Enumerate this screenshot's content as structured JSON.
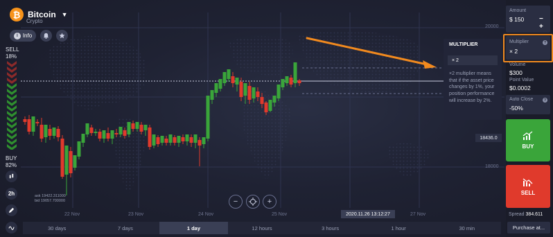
{
  "asset": {
    "name": "Bitcoin",
    "type": "Crypto"
  },
  "header_buttons": {
    "info": "Info"
  },
  "sentiment": {
    "sell_label": "SELL",
    "sell_pct": "18%",
    "buy_label": "BUY",
    "buy_pct": "82%",
    "sell_fraction": 0.18,
    "buy_fraction": 0.82
  },
  "left_tools": {
    "timeframe": "2h"
  },
  "chart": {
    "y_labels": [
      "20000",
      "18000"
    ],
    "x_labels": [
      "22 Nov",
      "23 Nov",
      "24 Nov",
      "25 Nov",
      "27 Nov"
    ],
    "bid_ask": [
      "ask 19422.311000",
      "bid 19057.700000"
    ],
    "current_price": "18436.0",
    "time": "2020.11.26 13:12:27",
    "up_color": "#3aa53a",
    "down_color": "#e03a2c"
  },
  "zoom": {
    "minus": "−",
    "plus": "+"
  },
  "multiplier_popup": {
    "title": "MULTIPLIER",
    "selected": "× 2",
    "description": "×2 multiplier means that if the asset price changes by 1%, your position performance will increase by 2%."
  },
  "trade_panel": {
    "amount_label": "Amount",
    "amount_value": "$ 150",
    "multiplier_label": "Multiplier",
    "multiplier_value": "× 2",
    "volume_label": "Volume",
    "volume_value": "$300",
    "point_value_label": "Point Value",
    "point_value_value": "$0.0002",
    "auto_close_label": "Auto Close",
    "auto_close_value": "-50%",
    "buy_label": "BUY",
    "sell_label": "SELL",
    "spread_label": "Spread",
    "spread_value": "384.611",
    "purchase_label": "Purchase at...",
    "highlight_color": "#f28a1e"
  },
  "timeframes": [
    {
      "label": "30 days",
      "active": false
    },
    {
      "label": "7 days",
      "active": false
    },
    {
      "label": "1 day",
      "active": true
    },
    {
      "label": "12 hours",
      "active": false
    },
    {
      "label": "3 hours",
      "active": false
    },
    {
      "label": "1 hour",
      "active": false
    },
    {
      "label": "30 min",
      "active": false
    }
  ]
}
